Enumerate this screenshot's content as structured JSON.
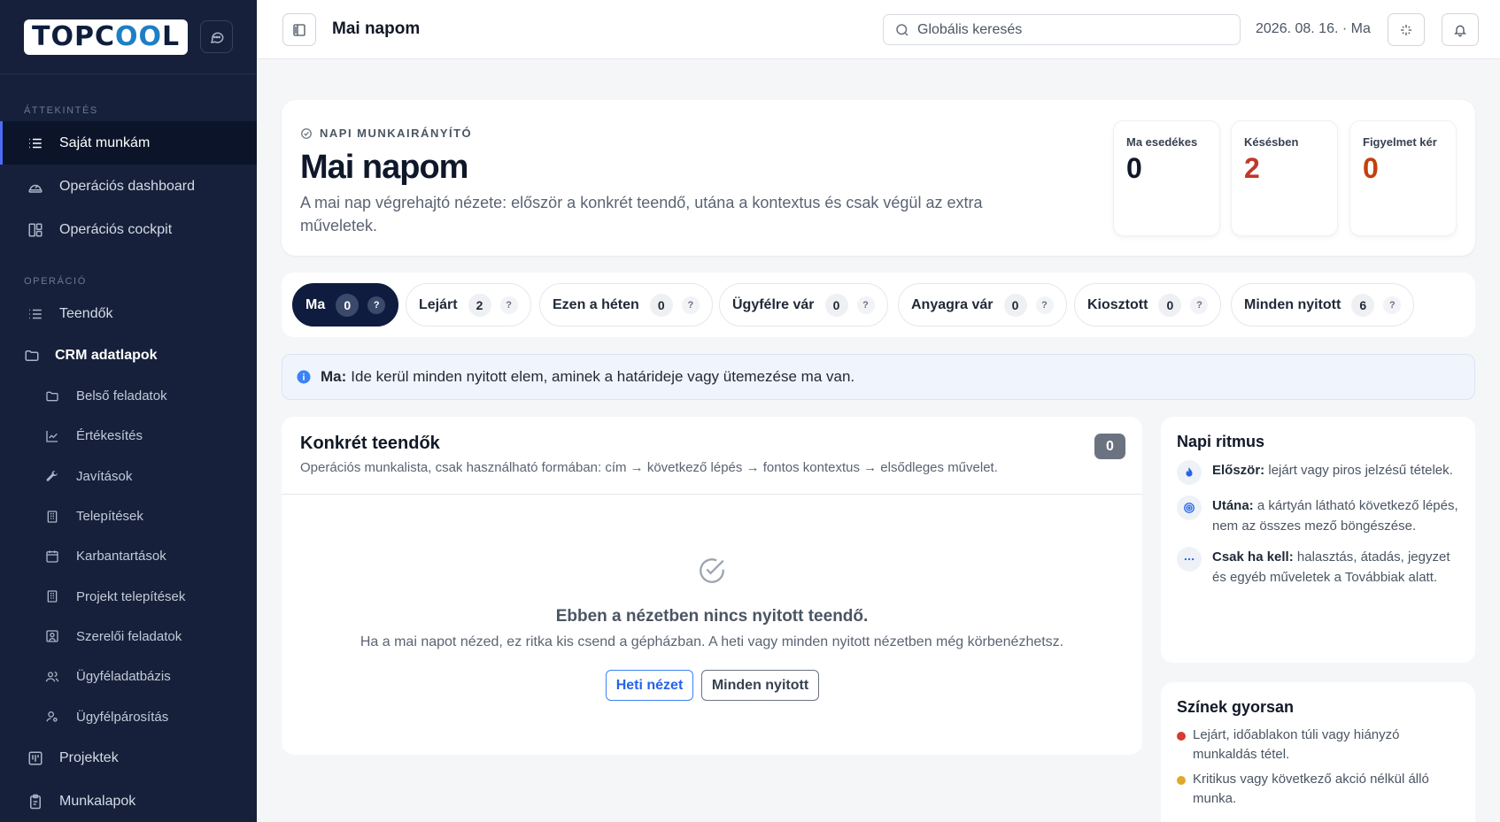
{
  "brand": {
    "logo_left": "TOPC",
    "logo_oo": "OO",
    "logo_right": "L"
  },
  "sidebar": {
    "section_overview": "ÁTTEKINTÉS",
    "overview_items": [
      {
        "label": "Saját munkám"
      },
      {
        "label": "Operációs dashboard"
      },
      {
        "label": "Operációs cockpit"
      }
    ],
    "section_operation": "OPERÁCIÓ",
    "operation_items": [
      {
        "label": "Teendők"
      }
    ],
    "crm_group": "CRM adatlapok",
    "crm_items": [
      {
        "label": "Belső feladatok"
      },
      {
        "label": "Értékesítés"
      },
      {
        "label": "Javítások"
      },
      {
        "label": "Telepítések"
      },
      {
        "label": "Karbantartások"
      },
      {
        "label": "Projekt telepítések"
      },
      {
        "label": "Szerelői feladatok"
      },
      {
        "label": "Ügyféladatbázis"
      },
      {
        "label": "Ügyfélpárosítás"
      }
    ],
    "bottom_items": [
      {
        "label": "Projektek"
      },
      {
        "label": "Munkalapok"
      }
    ]
  },
  "topbar": {
    "title": "Mai napom",
    "search_placeholder": "Globális keresés",
    "date": "2026. 08. 16. · Ma"
  },
  "hero": {
    "kicker": "NAPI MUNKAIRÁNYÍTÓ",
    "title": "Mai napom",
    "description": "A mai nap végrehajtó nézete: először a konkrét teendő, utána a kontextus és csak végül az extra műveletek.",
    "stats": [
      {
        "label": "Ma esedékes",
        "value": "0",
        "color": "#111827"
      },
      {
        "label": "Késésben",
        "value": "2",
        "color": "#c0392b"
      },
      {
        "label": "Figyelmet kér",
        "value": "0",
        "color": "#c2410c"
      }
    ]
  },
  "tabs": [
    {
      "label": "Ma",
      "count": "0",
      "help": "?"
    },
    {
      "label": "Lejárt",
      "count": "2",
      "help": "?"
    },
    {
      "label": "Ezen a héten",
      "count": "0",
      "help": "?"
    },
    {
      "label": "Ügyfélre vár",
      "count": "0",
      "help": "?"
    },
    {
      "label": "Anyagra vár",
      "count": "0",
      "help": "?"
    },
    {
      "label": "Kiosztott",
      "count": "0",
      "help": "?"
    },
    {
      "label": "Minden nyitott",
      "count": "6",
      "help": "?"
    }
  ],
  "info": {
    "strong": "Ma:",
    "text": "Ide kerül minden nyitott elem, aminek a határideje vagy ütemezése ma van."
  },
  "panel": {
    "title": "Konkrét teendők",
    "subtitle": "Operációs munkalista, csak használható formában: cím → következő lépés → fontos kontextus → elsődleges művelet.",
    "count": "0",
    "empty_title": "Ebben a nézetben nincs nyitott teendő.",
    "empty_desc": "Ha a mai napot nézed, ez ritka kis csend a gépházban. A heti vagy minden nyitott nézetben még körbenézhetsz.",
    "btn_week": "Heti nézet",
    "btn_all": "Minden nyitott"
  },
  "rhythm": {
    "title": "Napi ritmus",
    "items": [
      {
        "strong": "Először:",
        "text": "lejárt vagy piros jelzésű tételek."
      },
      {
        "strong": "Utána:",
        "text": "a kártyán látható következő lépés, nem az összes mező böngészése."
      },
      {
        "strong": "Csak ha kell:",
        "text": "halasztás, átadás, jegyzet és egyéb műveletek a Továbbiak alatt."
      }
    ]
  },
  "colors_card": {
    "title": "Színek gyorsan",
    "items": [
      {
        "text": "Lejárt, időablakon túli vagy hiányzó munkaldás tétel.",
        "color": "#d63b2f"
      },
      {
        "text": "Kritikus vagy következő akció nélkül álló munka.",
        "color": "#e0a92b"
      }
    ]
  }
}
